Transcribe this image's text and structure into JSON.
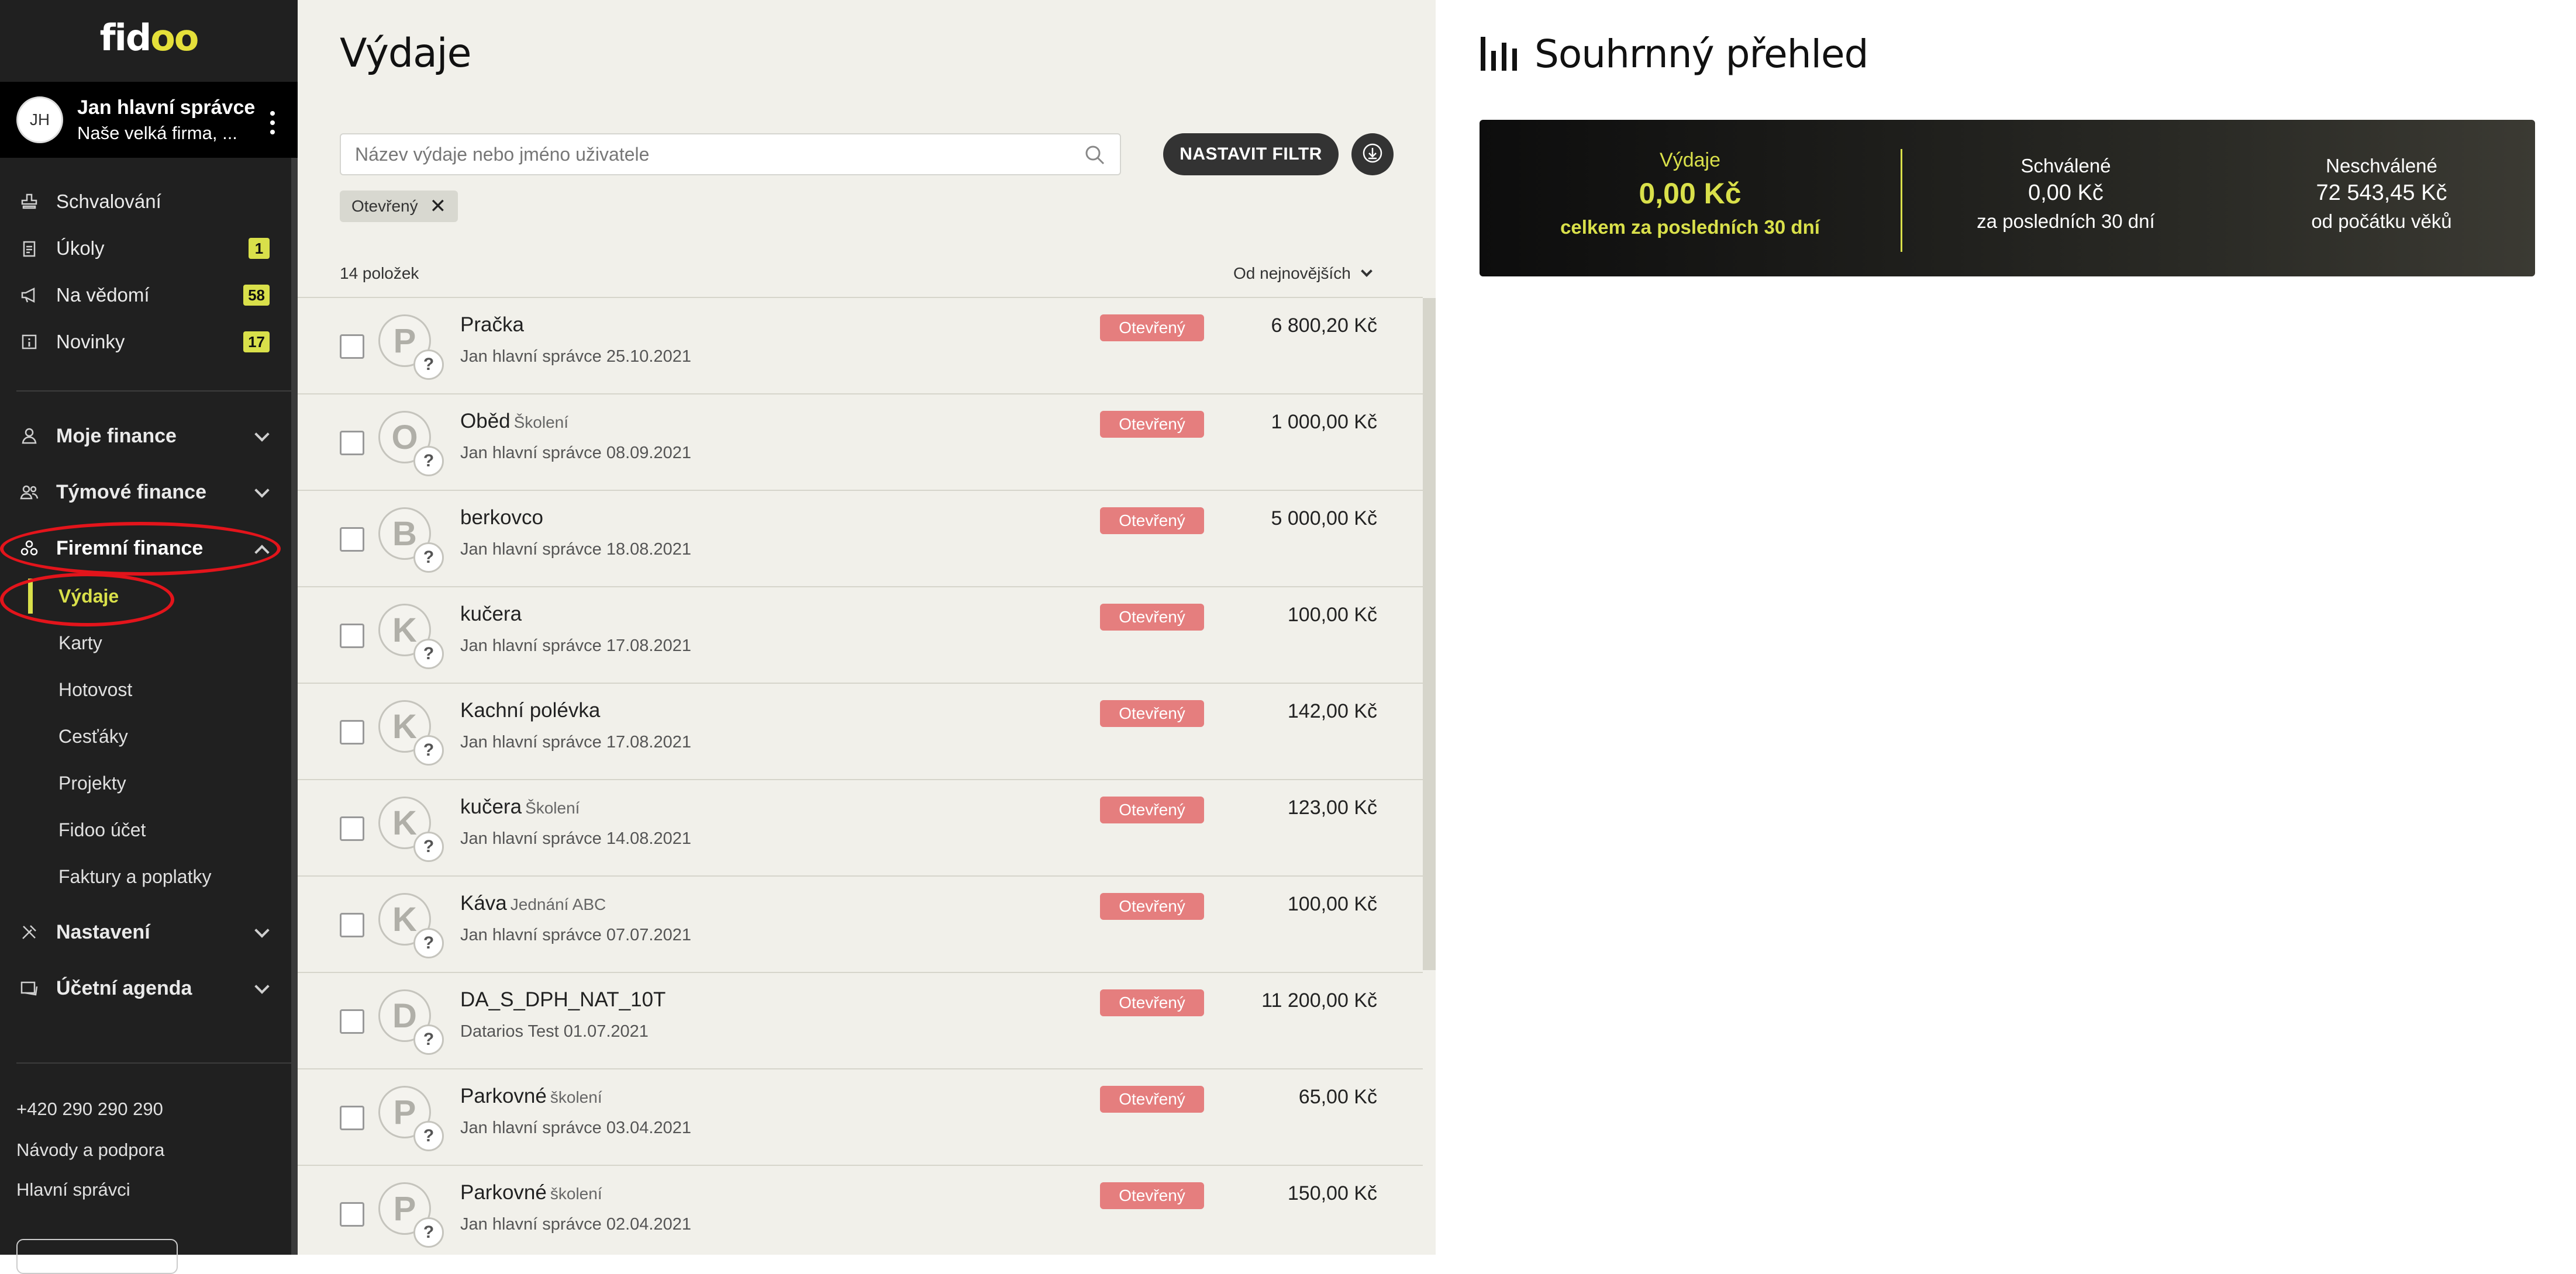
{
  "brand": {
    "logo_prefix": "fid",
    "logo_suffix": "oo"
  },
  "user": {
    "initials": "JH",
    "name": "Jan hlavní správce",
    "company": "Naše velká firma, ..."
  },
  "sidebar": {
    "top_items": [
      {
        "label": "Schvalování",
        "icon": "stamp-icon",
        "badge": ""
      },
      {
        "label": "Úkoly",
        "icon": "clipboard-icon",
        "badge": "1"
      },
      {
        "label": "Na vědomí",
        "icon": "megaphone-icon",
        "badge": "58"
      },
      {
        "label": "Novinky",
        "icon": "news-icon",
        "badge": "17"
      }
    ],
    "sections": [
      {
        "label": "Moje finance",
        "icon": "user-icon"
      },
      {
        "label": "Týmové finance",
        "icon": "team-icon"
      },
      {
        "label": "Firemní finance",
        "icon": "company-icon"
      },
      {
        "label": "Nastavení",
        "icon": "tools-icon"
      },
      {
        "label": "Účetní agenda",
        "icon": "accounting-icon"
      }
    ],
    "company_sub_items": [
      "Výdaje",
      "Karty",
      "Hotovost",
      "Cesťáky",
      "Projekty",
      "Fidoo účet",
      "Faktury a poplatky"
    ],
    "footer": {
      "phone": "+420 290 290 290",
      "help": "Návody a podpora",
      "admins": "Hlavní správci"
    }
  },
  "main": {
    "title": "Výdaje",
    "search_placeholder": "Název výdaje nebo jméno uživatele",
    "filter_button": "NASTAVIT FILTR",
    "active_chip": "Otevřený",
    "count_label": "14 položek",
    "sort_label": "Od nejnovějších",
    "expenses": [
      {
        "letter": "P",
        "title": "Pračka",
        "tag": "",
        "sub": "Jan hlavní správce 25.10.2021",
        "status": "Otevřený",
        "amount": "6 800,20 Kč"
      },
      {
        "letter": "O",
        "title": "Oběd",
        "tag": "Školení",
        "sub": "Jan hlavní správce 08.09.2021",
        "status": "Otevřený",
        "amount": "1 000,00 Kč"
      },
      {
        "letter": "B",
        "title": "berkovco",
        "tag": "",
        "sub": "Jan hlavní správce 18.08.2021",
        "status": "Otevřený",
        "amount": "5 000,00 Kč"
      },
      {
        "letter": "K",
        "title": "kučera",
        "tag": "",
        "sub": "Jan hlavní správce 17.08.2021",
        "status": "Otevřený",
        "amount": "100,00 Kč"
      },
      {
        "letter": "K",
        "title": "Kachní polévka",
        "tag": "",
        "sub": "Jan hlavní správce 17.08.2021",
        "status": "Otevřený",
        "amount": "142,00 Kč"
      },
      {
        "letter": "K",
        "title": "kučera",
        "tag": "Školení",
        "sub": "Jan hlavní správce 14.08.2021",
        "status": "Otevřený",
        "amount": "123,00 Kč"
      },
      {
        "letter": "K",
        "title": "Káva",
        "tag": "Jednání ABC",
        "sub": "Jan hlavní správce 07.07.2021",
        "status": "Otevřený",
        "amount": "100,00 Kč"
      },
      {
        "letter": "D",
        "title": "DA_S_DPH_NAT_10T",
        "tag": "",
        "sub": "Datarios Test 01.07.2021",
        "status": "Otevřený",
        "amount": "11 200,00 Kč"
      },
      {
        "letter": "P",
        "title": "Parkovné",
        "tag": "školení",
        "sub": "Jan hlavní správce 03.04.2021",
        "status": "Otevřený",
        "amount": "65,00 Kč"
      },
      {
        "letter": "P",
        "title": "Parkovné",
        "tag": "školení",
        "sub": "Jan hlavní správce 02.04.2021",
        "status": "Otevřený",
        "amount": "150,00 Kč"
      }
    ]
  },
  "overview": {
    "title": "Souhrnný přehled",
    "stats": [
      {
        "label": "Výdaje",
        "value": "0,00 Kč",
        "sub": "celkem za posledních 30 dní"
      },
      {
        "label": "Schválené",
        "value": "0,00 Kč",
        "sub": "za posledních 30 dní"
      },
      {
        "label": "Neschválené",
        "value": "72 543,45 Kč",
        "sub": "od počátku věků"
      }
    ]
  },
  "colors": {
    "accent": "#d9e04a",
    "sidebar_bg": "#202020",
    "status_open": "#e57e7e",
    "annotation": "#e3141b"
  }
}
